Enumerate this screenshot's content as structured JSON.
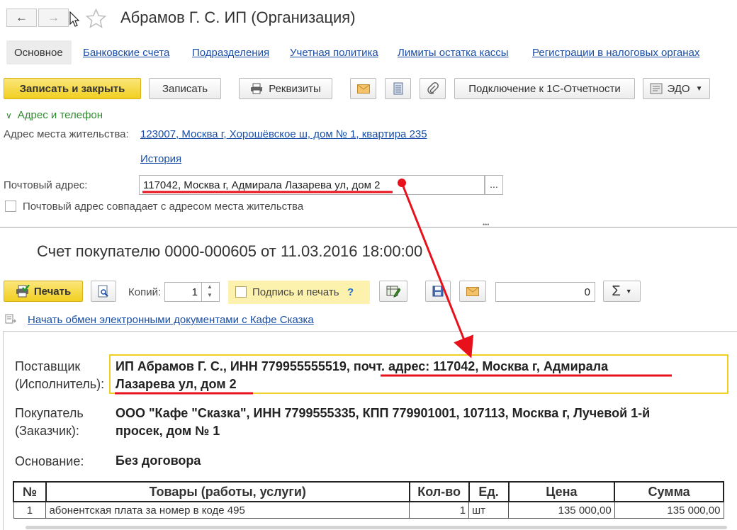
{
  "window": {
    "title": "Абрамов Г. С. ИП (Организация)"
  },
  "tabs": [
    {
      "label": "Основное"
    },
    {
      "label": "Банковские счета"
    },
    {
      "label": "Подразделения"
    },
    {
      "label": "Учетная политика"
    },
    {
      "label": "Лимиты остатка кассы"
    },
    {
      "label": "Регистрации в налоговых органах"
    }
  ],
  "toolbar": {
    "save_close": "Записать и закрыть",
    "save": "Записать",
    "requisites": "Реквизиты",
    "connect": "Подключение к 1С-Отчетности",
    "edo": "ЭДО"
  },
  "address_section": {
    "header": "Адрес и телефон",
    "residence_label": "Адрес места жительства:",
    "residence_value": "123007, Москва г, Хорошёвское ш, дом № 1, квартира 235",
    "history_link": "История",
    "postal_label": "Почтовый адрес:",
    "postal_value": "117042, Москва г, Адмирала Лазарева ул, дом 2",
    "postal_select": "...",
    "same_checkbox_label": "Почтовый адрес совпадает с адресом места жительства",
    "same_checked": false
  },
  "splitter": "•••",
  "invoice": {
    "title": "Счет покупателю 0000-000605 от 11.03.2016 18:00:00",
    "print_btn": "Печать",
    "copies_label": "Копий:",
    "copies_value": "1",
    "sign_label": "Подпись и печать",
    "help_mark": "?",
    "sign_checked": false,
    "sum_value": "0",
    "sigma": "Σ",
    "edo_link": "Начать обмен электронными документами с Кафе Сказка"
  },
  "document": {
    "supplier_label_1": "Поставщик",
    "supplier_label_2": "(Исполнитель):",
    "supplier_line_1": "ИП Абрамов Г. С., ИНН 779955555519, почт. адрес: 117042, Москва г, Адмирала",
    "supplier_line_2": "Лазарева ул, дом 2",
    "buyer_label_1": "Покупатель",
    "buyer_label_2": "(Заказчик):",
    "buyer_line_1": "ООО \"Кафе \"Сказка\", ИНН 7799555335, КПП 779901001, 107113, Москва г, Лучевой 1-й",
    "buyer_line_2": "просек, дом № 1",
    "basis_label": "Основание:",
    "basis_value": "Без договора",
    "table": {
      "headers": [
        "№",
        "Товары (работы, услуги)",
        "Кол-во",
        "Ед.",
        "Цена",
        "Сумма"
      ],
      "rows": [
        [
          "1",
          "абонентская плата за номер в коде 495",
          "1",
          "шт",
          "135 000,00",
          "135 000,00"
        ]
      ]
    }
  },
  "colors": {
    "accent_yellow": "#f1cf21",
    "link_blue": "#1a4ea6",
    "annotation_red": "#e8101b",
    "section_green": "#2e8b2e"
  }
}
